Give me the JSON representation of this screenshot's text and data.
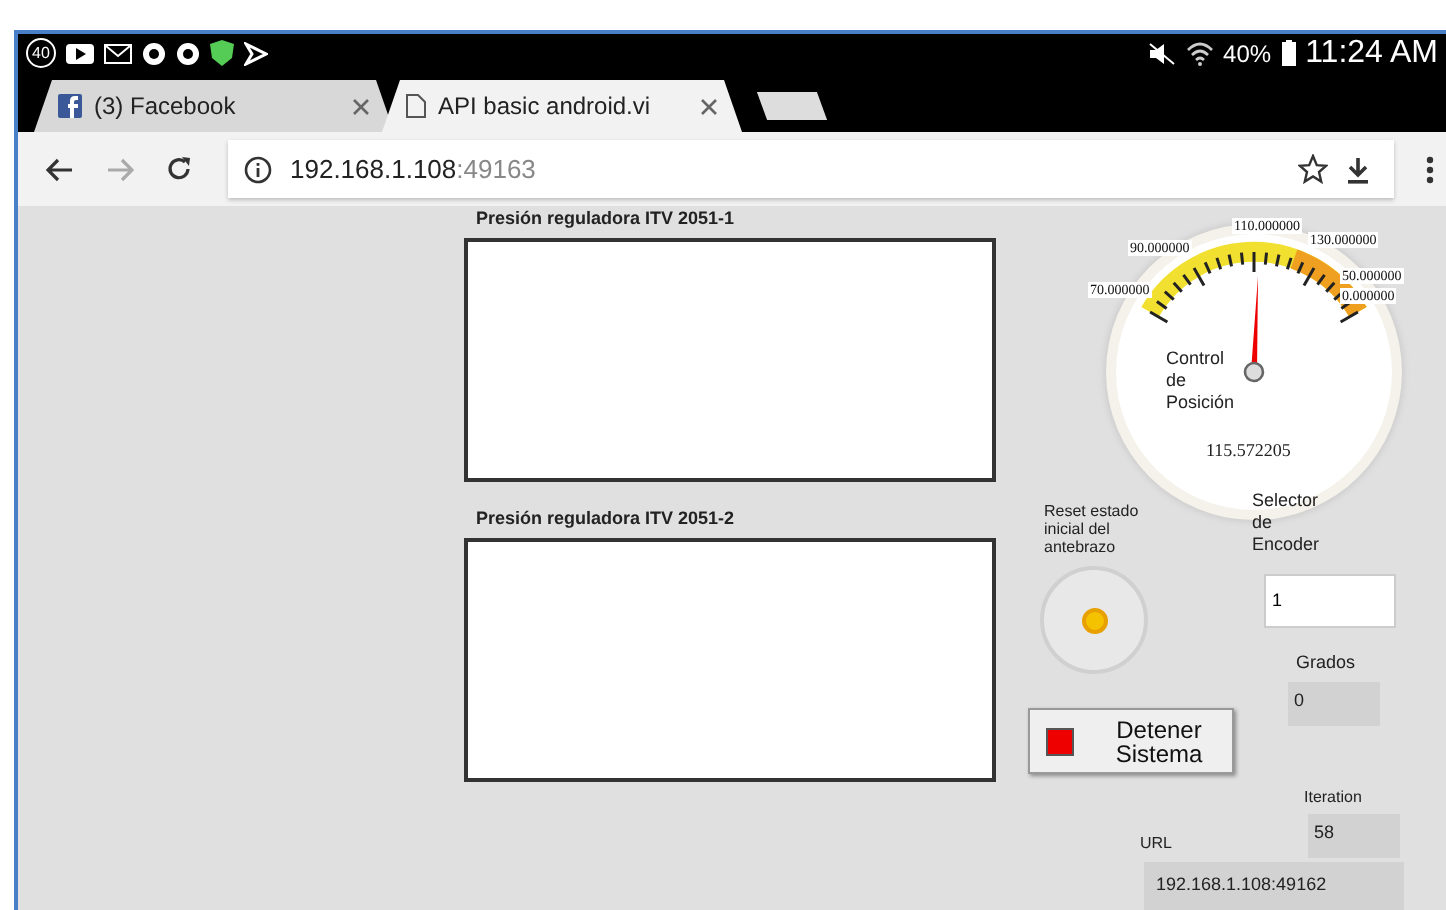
{
  "status_bar": {
    "notification_count": "40",
    "battery": "40%",
    "time": "11:24 AM"
  },
  "tabs": [
    {
      "title": "(3) Facebook",
      "kind": "facebook",
      "selected": false
    },
    {
      "title": "API basic android.vi",
      "kind": "page",
      "selected": true
    }
  ],
  "address_bar": {
    "host": "192.168.1.108",
    "port": ":49163"
  },
  "panel": {
    "charts": [
      {
        "title": "Presión reguladora ITV 2051-1"
      },
      {
        "title": "Presión reguladora ITV 2051-2"
      }
    ],
    "gauge": {
      "label": "Control de Posición",
      "value": "115.572205",
      "level": 0.52,
      "ticks": [
        "70.000000",
        "90.000000",
        "110.000000",
        "130.000000",
        "50.000000",
        "0.000000"
      ]
    },
    "reset_knob": {
      "label": "Reset estado inicial del antebrazo"
    },
    "encoder_selector": {
      "label": "Selector de Encoder",
      "value": "1"
    },
    "degrees": {
      "label": "Grados",
      "value": "0"
    },
    "stop_button": {
      "label": "Detener Sistema",
      "on": true
    },
    "iteration": {
      "label": "Iteration",
      "value": "58"
    },
    "url": {
      "label": "URL",
      "value": "192.168.1.108:49162"
    }
  }
}
